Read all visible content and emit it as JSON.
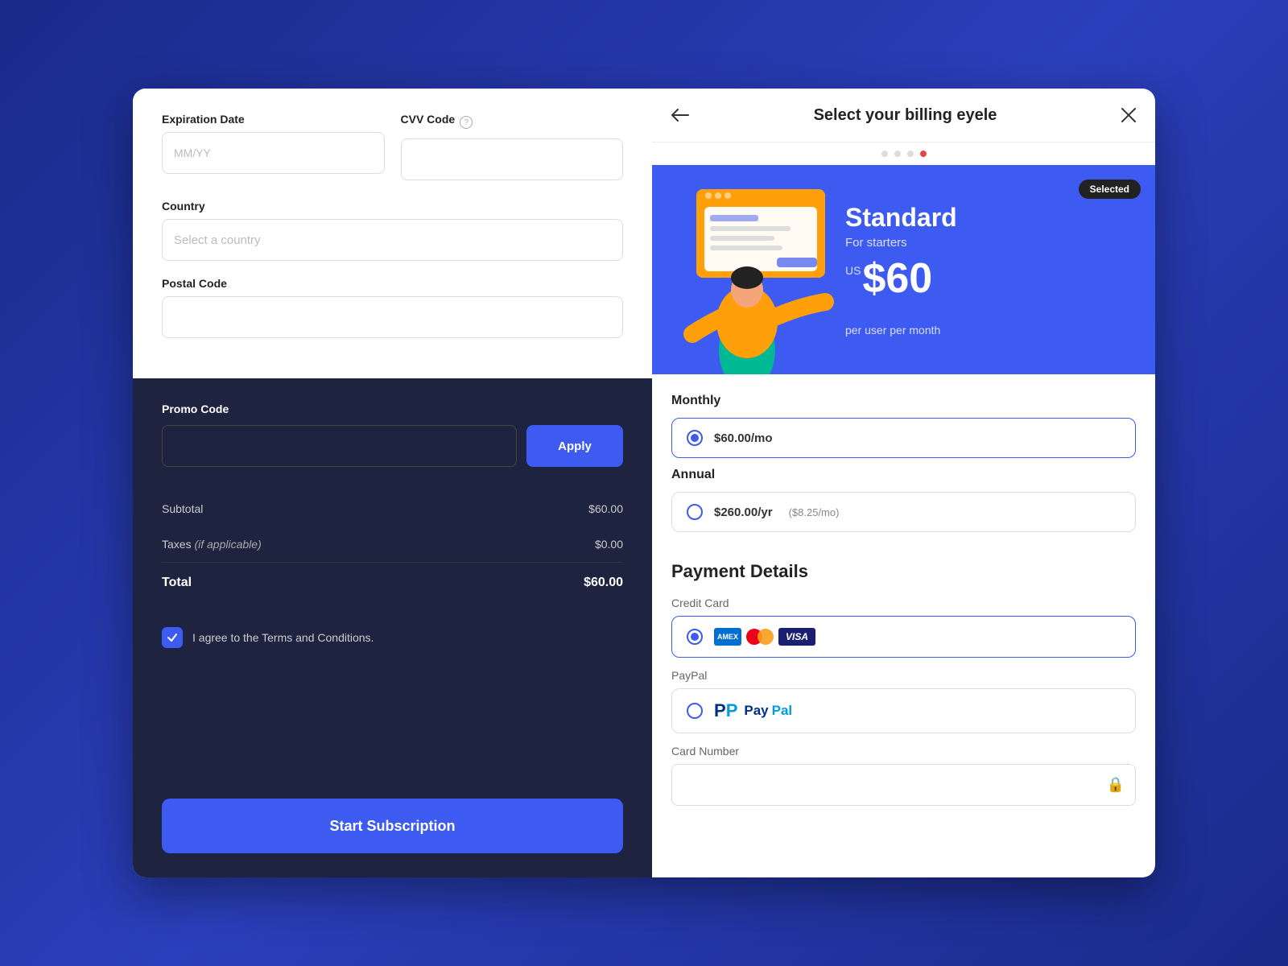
{
  "left": {
    "expiration_date": {
      "label": "Expiration Date",
      "placeholder": "MM/YY"
    },
    "cvv_code": {
      "label": "CVV Code",
      "placeholder": ""
    },
    "country": {
      "label": "Country",
      "placeholder": "Select a country"
    },
    "postal_code": {
      "label": "Postal Code",
      "placeholder": ""
    },
    "promo_code": {
      "label": "Promo Code",
      "placeholder": "",
      "apply_btn": "Apply"
    },
    "subtotal_label": "Subtotal",
    "subtotal_value": "$60.00",
    "taxes_label": "Taxes",
    "taxes_note": "(if applicable)",
    "taxes_value": "$0.00",
    "total_label": "Total",
    "total_value": "$60.00",
    "terms_text": "I agree to the Terms and Conditions.",
    "start_btn": "Start Subscription"
  },
  "right": {
    "back_btn": "←",
    "header_title": "Select your billing\neyele",
    "close_btn": "×",
    "dots": [
      "inactive",
      "inactive",
      "inactive",
      "active"
    ],
    "plan": {
      "selected_badge": "Selected",
      "name": "Standard",
      "subtitle": "For starters",
      "currency": "US",
      "price": "$60",
      "period": "per user per month"
    },
    "monthly": {
      "label": "Monthly",
      "price": "$60.00/mo",
      "selected": true
    },
    "annual": {
      "label": "Annual",
      "price": "$260.00/yr",
      "savings": "($8.25/mo)",
      "selected": false
    },
    "payment_details_title": "Payment Details",
    "credit_card": {
      "label": "Credit Card",
      "selected": true
    },
    "paypal": {
      "label": "PayPal",
      "selected": false
    },
    "card_number": {
      "label": "Card Number",
      "placeholder": ""
    }
  }
}
